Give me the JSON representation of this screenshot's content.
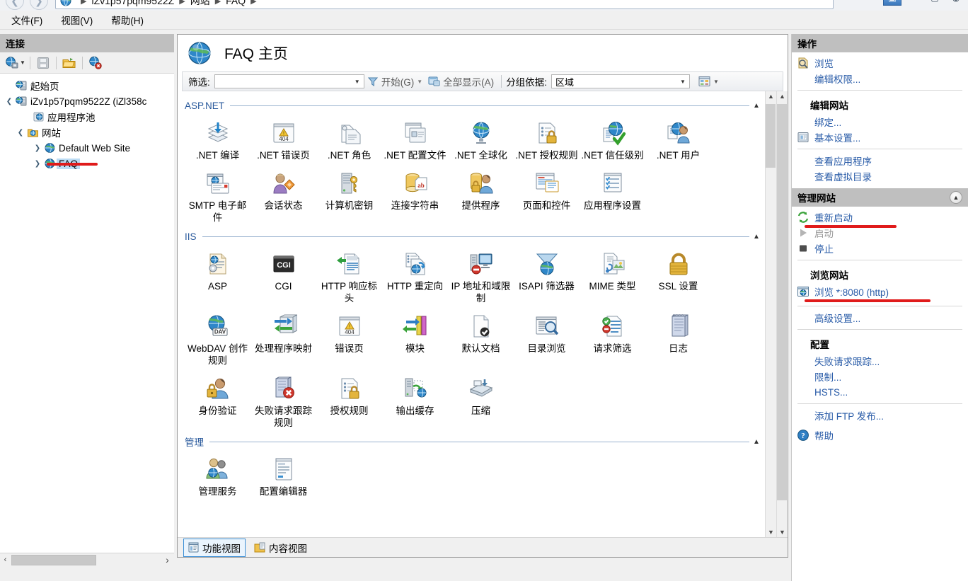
{
  "window": {
    "breadcrumb": [
      "iZv1p57pqm9522Z",
      "网站",
      "FAQ"
    ],
    "nav_back_icon": "arrow-left-icon",
    "nav_forward_icon": "arrow-right-icon",
    "controls": [
      "minimize",
      "maximize",
      "close",
      "help"
    ]
  },
  "menubar": {
    "items": [
      {
        "label": "文件(F)"
      },
      {
        "label": "视图(V)"
      },
      {
        "label": "帮助(H)"
      }
    ]
  },
  "connections": {
    "title": "连接",
    "toolbar": [
      {
        "name": "connect-to-icon",
        "icon": "globe-plug-icon"
      },
      {
        "name": "save-connections-icon",
        "icon": "save-icon"
      },
      {
        "name": "open-site-icon",
        "icon": "folder-open-icon"
      },
      {
        "name": "disconnect-icon",
        "icon": "globe-delete-icon"
      }
    ],
    "tree": [
      {
        "label": "起始页",
        "icon": "start-page-icon",
        "depth": 0,
        "expander": "",
        "selected": false
      },
      {
        "label": "iZv1p57pqm9522Z (iZl358c",
        "icon": "server-icon",
        "depth": 0,
        "expander": "expanded",
        "selected": false
      },
      {
        "label": "应用程序池",
        "icon": "app-pools-icon",
        "depth": 1,
        "expander": "",
        "selected": false
      },
      {
        "label": "网站",
        "icon": "sites-folder-icon",
        "depth": 1,
        "expander": "expanded",
        "selected": false
      },
      {
        "label": "Default Web Site",
        "icon": "site-globe-icon",
        "depth": 2,
        "expander": "collapsed",
        "selected": false
      },
      {
        "label": "FAQ",
        "icon": "site-globe-icon",
        "depth": 2,
        "expander": "collapsed",
        "selected": true
      }
    ],
    "hscroll": {
      "left_arrow": "‹",
      "right_arrow": "›"
    }
  },
  "main": {
    "page_title": "FAQ 主页",
    "page_icon": "globe-icon",
    "filterbar": {
      "filter_label": "筛选:",
      "filter_value": "",
      "filter_placeholder": "",
      "go_label": "开始(G)",
      "go_icon": "funnel-icon",
      "showall_label": "全部显示(A)",
      "showall_icon": "show-all-icon",
      "groupby_label": "分组依据:",
      "groupby_value": "区域",
      "viewmode_icon": "view-mode-icon"
    },
    "groups": [
      {
        "name": "ASP.NET",
        "collapse_icon": "chevron-up-icon",
        "tiles": [
          {
            "label": ".NET 编译",
            "icon": "net-compilation-icon"
          },
          {
            "label": ".NET 错误页",
            "icon": "net-error-pages-icon"
          },
          {
            "label": ".NET 角色",
            "icon": "net-roles-icon"
          },
          {
            "label": ".NET 配置文件",
            "icon": "net-profile-icon"
          },
          {
            "label": ".NET 全球化",
            "icon": "net-globalization-icon"
          },
          {
            "label": ".NET 授权规则",
            "icon": "net-authorization-icon"
          },
          {
            "label": ".NET 信任级别",
            "icon": "net-trust-levels-icon"
          },
          {
            "label": ".NET 用户",
            "icon": "net-users-icon"
          },
          {
            "label": "SMTP 电子邮件",
            "icon": "smtp-email-icon"
          },
          {
            "label": "会话状态",
            "icon": "session-state-icon"
          },
          {
            "label": "计算机密钥",
            "icon": "machine-key-icon"
          },
          {
            "label": "连接字符串",
            "icon": "connection-strings-icon"
          },
          {
            "label": "提供程序",
            "icon": "providers-icon"
          },
          {
            "label": "页面和控件",
            "icon": "pages-and-controls-icon"
          },
          {
            "label": "应用程序设置",
            "icon": "app-settings-icon"
          }
        ]
      },
      {
        "name": "IIS",
        "collapse_icon": "chevron-up-icon",
        "tiles": [
          {
            "label": "ASP",
            "icon": "asp-icon"
          },
          {
            "label": "CGI",
            "icon": "cgi-icon"
          },
          {
            "label": "HTTP 响应标头",
            "icon": "http-response-headers-icon"
          },
          {
            "label": "HTTP 重定向",
            "icon": "http-redirect-icon"
          },
          {
            "label": "IP 地址和域限制",
            "icon": "ip-restrictions-icon"
          },
          {
            "label": "ISAPI 筛选器",
            "icon": "isapi-filters-icon"
          },
          {
            "label": "MIME 类型",
            "icon": "mime-types-icon"
          },
          {
            "label": "SSL 设置",
            "icon": "ssl-settings-icon"
          },
          {
            "label": "WebDAV 创作规则",
            "icon": "webdav-icon"
          },
          {
            "label": "处理程序映射",
            "icon": "handler-mappings-icon"
          },
          {
            "label": "错误页",
            "icon": "error-pages-icon"
          },
          {
            "label": "模块",
            "icon": "modules-icon"
          },
          {
            "label": "默认文档",
            "icon": "default-document-icon"
          },
          {
            "label": "目录浏览",
            "icon": "directory-browsing-icon"
          },
          {
            "label": "请求筛选",
            "icon": "request-filtering-icon"
          },
          {
            "label": "日志",
            "icon": "logging-icon"
          },
          {
            "label": "身份验证",
            "icon": "authentication-icon"
          },
          {
            "label": "失败请求跟踪规则",
            "icon": "failed-request-tracing-icon"
          },
          {
            "label": "授权规则",
            "icon": "authorization-rules-icon"
          },
          {
            "label": "输出缓存",
            "icon": "output-caching-icon"
          },
          {
            "label": "压缩",
            "icon": "compression-icon"
          }
        ]
      },
      {
        "name": "管理",
        "collapse_icon": "chevron-up-icon",
        "tiles": [
          {
            "label": "管理服务",
            "icon": "management-service-icon"
          },
          {
            "label": "配置编辑器",
            "icon": "configuration-editor-icon"
          }
        ]
      }
    ],
    "view_tabs": [
      {
        "label": "功能视图",
        "icon": "features-view-icon",
        "active": true
      },
      {
        "label": "内容视图",
        "icon": "content-view-icon",
        "active": false
      }
    ],
    "scrollbar": {
      "up_arrow": "▲",
      "down_arrow": "▼"
    }
  },
  "actions": {
    "title": "操作",
    "sections": [
      {
        "header": "",
        "items": [
          {
            "label": "浏览",
            "icon": "browse-icon",
            "disabled": false,
            "bold": false
          },
          {
            "label": "编辑权限...",
            "icon": "",
            "disabled": false,
            "bold": false
          }
        ]
      },
      {
        "header": "编辑网站",
        "items": [
          {
            "label": "绑定...",
            "icon": "",
            "disabled": false,
            "bold": false
          },
          {
            "label": "基本设置...",
            "icon": "basic-settings-icon",
            "disabled": false,
            "bold": false
          }
        ]
      },
      {
        "header": "",
        "items": [
          {
            "label": "查看应用程序",
            "icon": "",
            "disabled": false,
            "bold": false
          },
          {
            "label": "查看虚拟目录",
            "icon": "",
            "disabled": false,
            "bold": false
          }
        ]
      }
    ],
    "manage_site": {
      "title": "管理网站",
      "collapse_icon": "chevron-up-icon",
      "items": [
        {
          "label": "重新启动",
          "icon": "restart-icon",
          "disabled": false,
          "annotated": true
        },
        {
          "label": "启动",
          "icon": "start-icon",
          "disabled": true,
          "annotated": false
        },
        {
          "label": "停止",
          "icon": "stop-icon",
          "disabled": false,
          "annotated": false
        }
      ]
    },
    "browse_site": {
      "header": "浏览网站",
      "items": [
        {
          "label": "浏览 *:8080 (http)",
          "icon": "browse-site-icon",
          "disabled": false,
          "annotated": true
        }
      ]
    },
    "advanced": {
      "items": [
        {
          "label": "高级设置...",
          "icon": "",
          "disabled": false
        }
      ]
    },
    "configure": {
      "header": "配置",
      "items": [
        {
          "label": "失败请求跟踪...",
          "icon": "",
          "disabled": false
        },
        {
          "label": "限制...",
          "icon": "",
          "disabled": false
        },
        {
          "label": "HSTS...",
          "icon": "",
          "disabled": false
        }
      ]
    },
    "footer": {
      "items": [
        {
          "label": "添加 FTP 发布...",
          "icon": "",
          "disabled": false
        },
        {
          "label": "帮助",
          "icon": "help-icon",
          "disabled": false
        }
      ]
    }
  },
  "colors": {
    "link": "#2a5ca8",
    "group_header": "#2a5a9c",
    "selection": "#bcdcf4",
    "annotation": "#e01b1b",
    "pane_title_bg": "#bfbfbf"
  }
}
